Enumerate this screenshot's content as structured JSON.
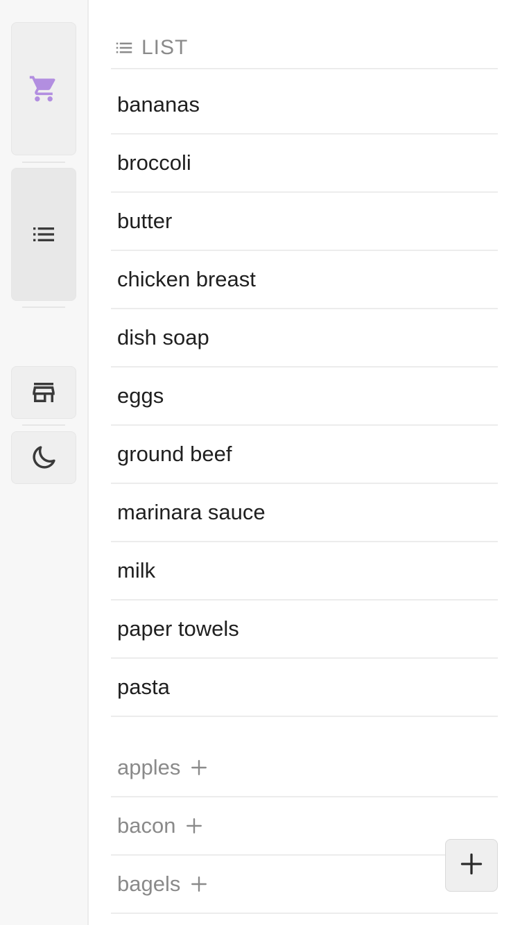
{
  "sidebar": {
    "buttons": [
      {
        "name": "shop",
        "icon": "shopping-cart-icon",
        "color": "#b28ee0"
      },
      {
        "name": "list",
        "icon": "list-icon",
        "color": "#3a3a3a"
      },
      {
        "name": "stores",
        "icon": "storefront-icon",
        "color": "#3a3a3a"
      },
      {
        "name": "theme",
        "icon": "moon-icon",
        "color": "#3a3a3a"
      }
    ]
  },
  "header": {
    "title": "LIST",
    "icon": "list-icon"
  },
  "list": {
    "items": [
      "bananas",
      "broccoli",
      "butter",
      "chicken breast",
      "dish soap",
      "eggs",
      "ground beef",
      "marinara sauce",
      "milk",
      "paper towels",
      "pasta"
    ],
    "suggestions": [
      "apples",
      "bacon",
      "bagels"
    ]
  },
  "fab": {
    "icon": "plus-icon"
  },
  "colors": {
    "accent": "#b28ee0",
    "text": "#1f1f1f",
    "muted": "#8a8a8a",
    "divider": "#ececec"
  }
}
